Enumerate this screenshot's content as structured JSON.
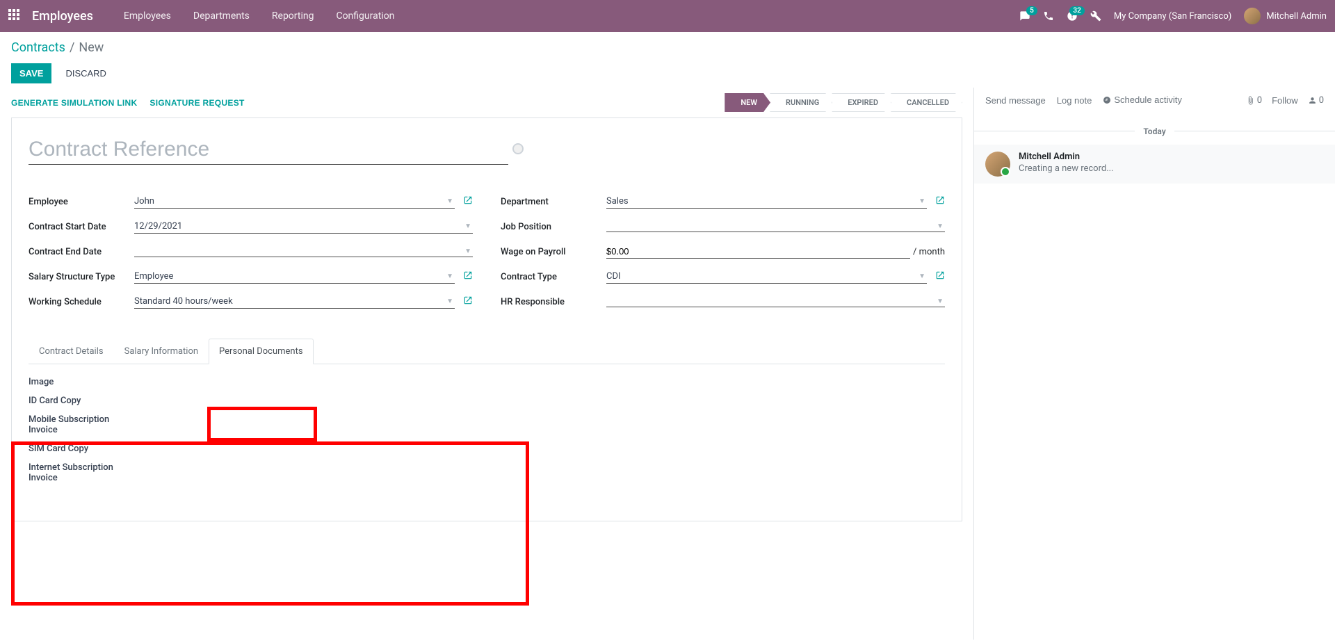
{
  "topbar": {
    "app_title": "Employees",
    "nav": [
      "Employees",
      "Departments",
      "Reporting",
      "Configuration"
    ],
    "msg_badge": "5",
    "activity_badge": "32",
    "company": "My Company (San Francisco)",
    "user": "Mitchell Admin"
  },
  "breadcrumb": {
    "root": "Contracts",
    "current": "New"
  },
  "buttons": {
    "save": "SAVE",
    "discard": "DISCARD"
  },
  "status_actions": {
    "simulation": "GENERATE SIMULATION LINK",
    "signature": "SIGNATURE REQUEST"
  },
  "stages": {
    "new": "NEW",
    "running": "RUNNING",
    "expired": "EXPIRED",
    "cancelled": "CANCELLED"
  },
  "form": {
    "title_placeholder": "Contract Reference",
    "left": {
      "employee_label": "Employee",
      "employee_value": "John",
      "start_date_label": "Contract Start Date",
      "start_date_value": "12/29/2021",
      "end_date_label": "Contract End Date",
      "end_date_value": "",
      "structure_label": "Salary Structure Type",
      "structure_value": "Employee",
      "schedule_label": "Working Schedule",
      "schedule_value": "Standard 40 hours/week"
    },
    "right": {
      "department_label": "Department",
      "department_value": "Sales",
      "position_label": "Job Position",
      "position_value": "",
      "wage_label": "Wage on Payroll",
      "wage_value": "$0.00",
      "wage_suffix": "/ month",
      "contract_type_label": "Contract Type",
      "contract_type_value": "CDI",
      "hr_label": "HR Responsible",
      "hr_value": ""
    }
  },
  "tabs": {
    "details": "Contract Details",
    "salary": "Salary Information",
    "personal": "Personal Documents"
  },
  "personal_docs": {
    "image": "Image",
    "id_card": "ID Card Copy",
    "mobile": "Mobile Subscription Invoice",
    "sim": "SIM Card Copy",
    "internet": "Internet Subscription Invoice"
  },
  "chatter": {
    "send": "Send message",
    "log": "Log note",
    "schedule": "Schedule activity",
    "attach_count": "0",
    "follow": "Follow",
    "followers": "0",
    "today": "Today",
    "msg_author": "Mitchell Admin",
    "msg_text": "Creating a new record..."
  }
}
